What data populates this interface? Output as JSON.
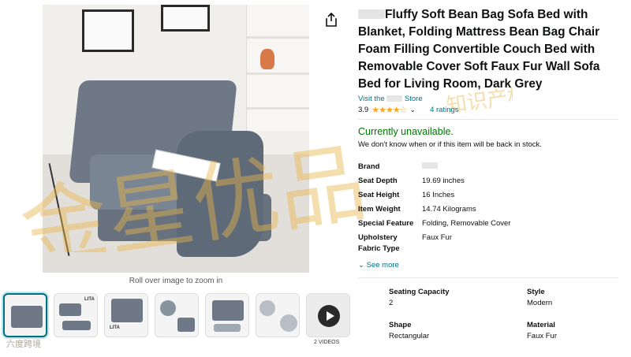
{
  "product": {
    "title": "Fluffy Soft Bean Bag Sofa Bed with Blanket, Folding Mattress Bean Bag Chair Foam Filling Convertible Couch Bed with Removable Cover Soft Faux Fur Wall Sofa Bed for Living Room, Dark Grey",
    "store_prefix": "Visit the",
    "store_suffix": "Store",
    "rating_value": "3.9",
    "ratings_count": "4 ratings",
    "availability": "Currently unavailable.",
    "restock_note": "We don't know when or if this item will be back in stock."
  },
  "specs": [
    {
      "key": "Brand",
      "value": ""
    },
    {
      "key": "Seat Depth",
      "value": "19.69 inches"
    },
    {
      "key": "Seat Height",
      "value": "16 Inches"
    },
    {
      "key": "Item Weight",
      "value": "14.74 Kilograms"
    },
    {
      "key": "Special Feature",
      "value": "Folding, Removable Cover"
    },
    {
      "key": "Upholstery Fabric Type",
      "value": "Faux Fur"
    }
  ],
  "see_more": "See more",
  "details": [
    {
      "key": "Seating Capacity",
      "value": "2"
    },
    {
      "key": "Style",
      "value": "Modern"
    },
    {
      "key": "Shape",
      "value": "Rectangular"
    },
    {
      "key": "Material",
      "value": "Faux Fur"
    }
  ],
  "gallery": {
    "zoom_hint": "Roll over image to zoom in",
    "thumbnail_labels": [
      "LITA",
      "LITA"
    ],
    "video_label": "2 VIDEOS"
  },
  "watermark_text": "金星优品 知识产权",
  "logo_text": "六度跨境",
  "colors": {
    "link": "#007185",
    "available_green": "#007600",
    "star": "#ffa41c",
    "selected_border": "#007185"
  }
}
